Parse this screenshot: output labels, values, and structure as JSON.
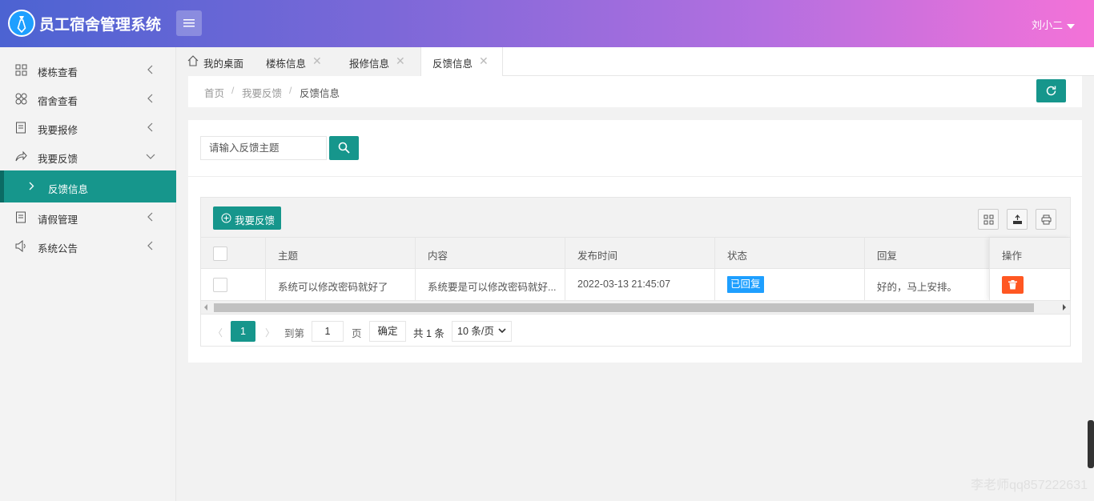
{
  "app": {
    "title": "员工宿舍管理系统",
    "user": "刘小二"
  },
  "sidebar": {
    "items": [
      {
        "label": "楼栋查看",
        "icon": "grid-icon"
      },
      {
        "label": "宿舍查看",
        "icon": "clover-icon"
      },
      {
        "label": "我要报修",
        "icon": "form-icon"
      },
      {
        "label": "我要反馈",
        "icon": "share-icon"
      },
      {
        "label": "请假管理",
        "icon": "form-icon"
      },
      {
        "label": "系统公告",
        "icon": "speaker-icon"
      }
    ],
    "sub_item": {
      "label": "反馈信息"
    }
  },
  "tabs": [
    {
      "label": "我的桌面",
      "icon": "home-icon"
    },
    {
      "label": "楼栋信息"
    },
    {
      "label": "报修信息"
    },
    {
      "label": "反馈信息",
      "active": true
    }
  ],
  "breadcrumb": {
    "items": [
      "首页",
      "我要反馈",
      "反馈信息"
    ],
    "separator": "/"
  },
  "search": {
    "placeholder": "请输入反馈主题"
  },
  "toolbar": {
    "add_label": "我要反馈"
  },
  "table": {
    "columns": [
      "主题",
      "内容",
      "发布时间",
      "状态",
      "回复",
      "操作"
    ],
    "rows": [
      {
        "subject": "系统可以修改密码就好了",
        "content": "系统要是可以修改密码就好...",
        "time": "2022-03-13 21:45:07",
        "status": "已回复",
        "reply": "好的，马上安排。"
      }
    ]
  },
  "pager": {
    "current": "1",
    "goto_label": "到第",
    "goto_value": "1",
    "page_label": "页",
    "confirm_label": "确定",
    "total": "共 1 条",
    "page_size": "10 条/页"
  },
  "watermark": "李老师qq857222631",
  "colors": {
    "primary": "#16968c",
    "badge": "#1e9fff",
    "danger": "#ff5722"
  }
}
